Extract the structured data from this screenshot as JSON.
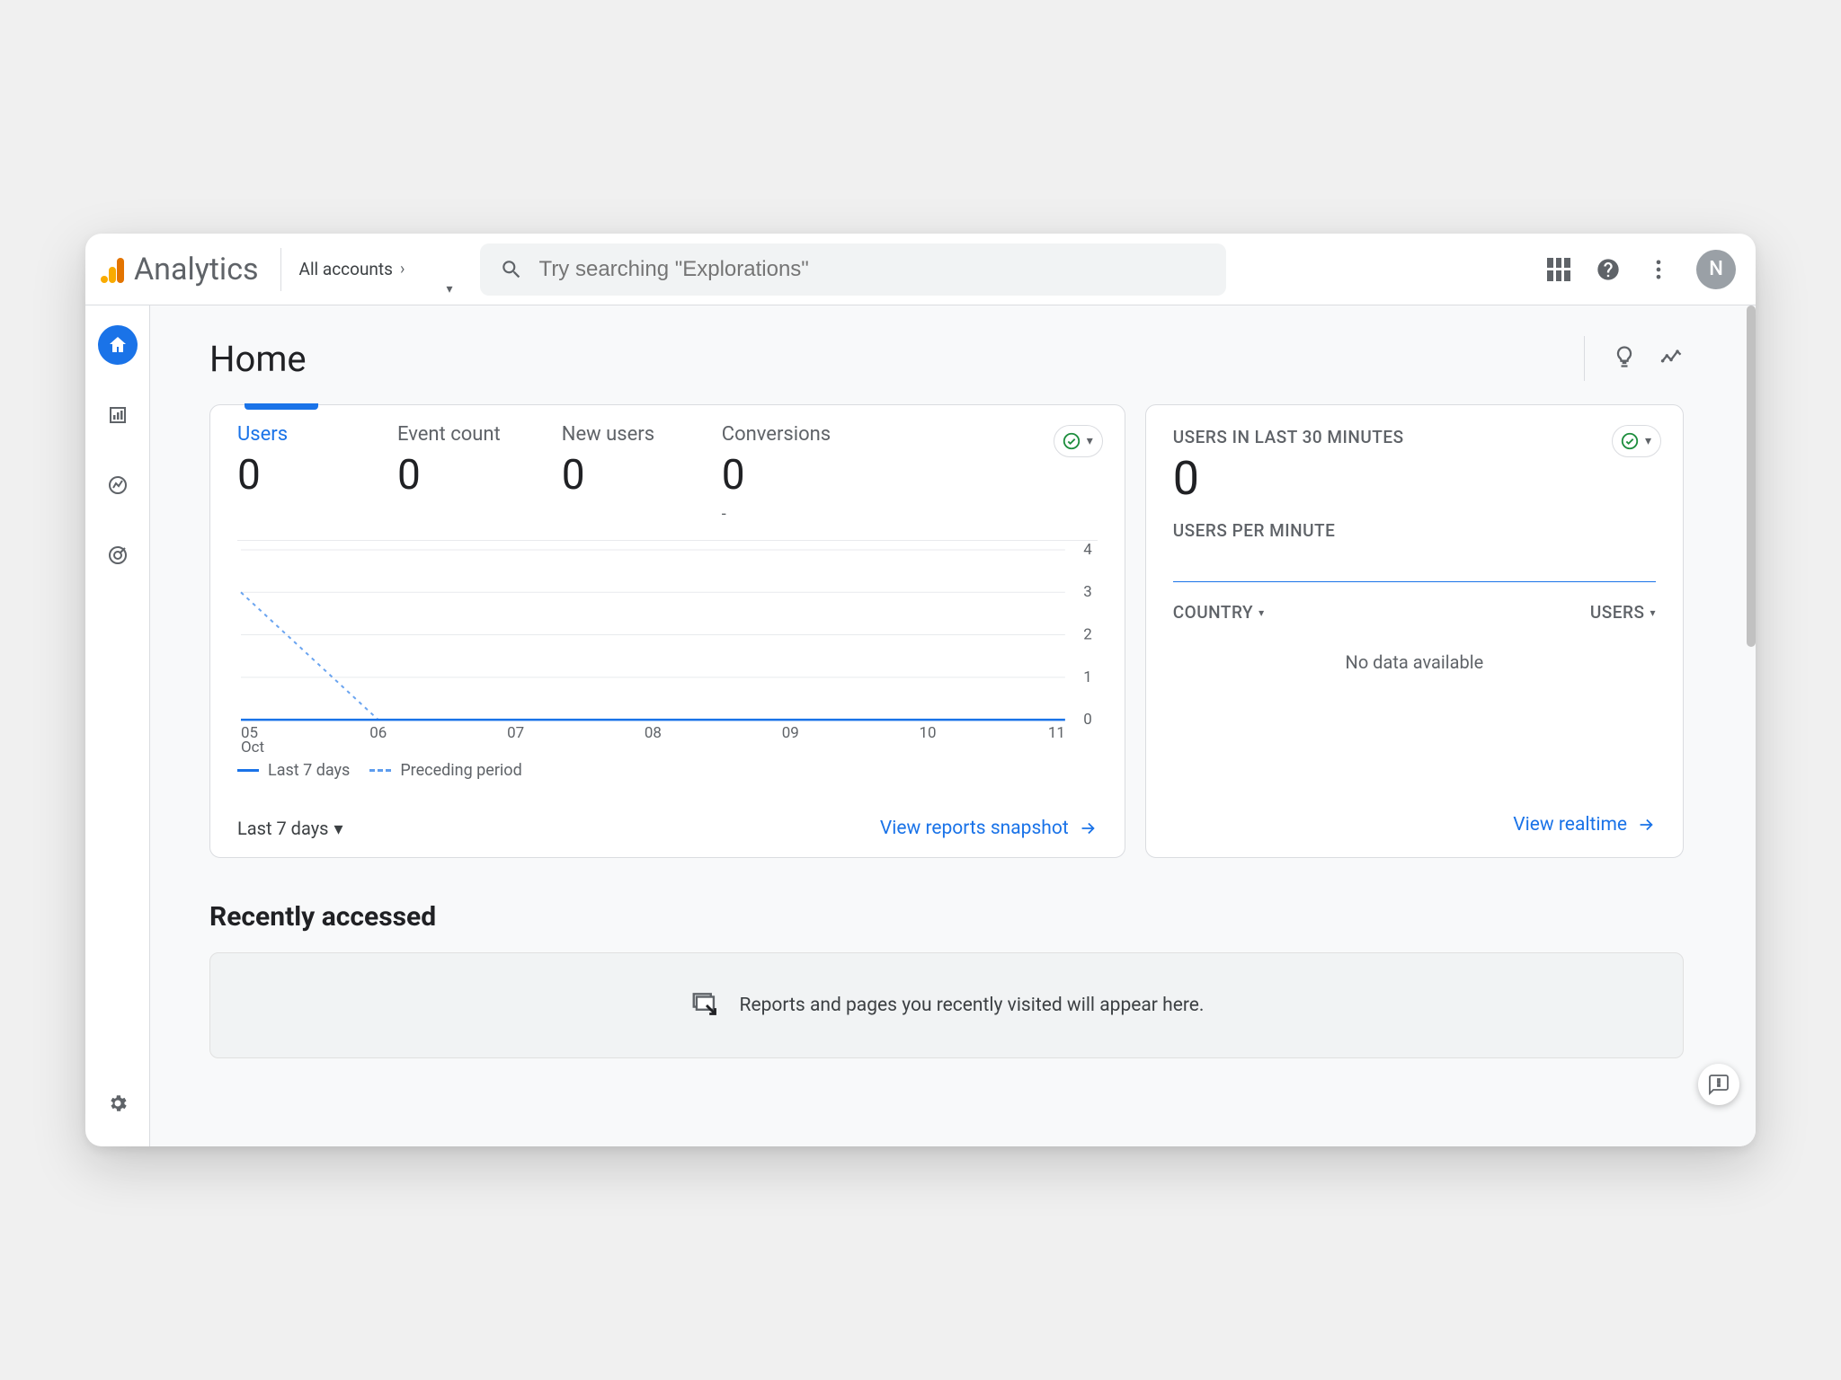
{
  "header": {
    "product_name": "Analytics",
    "account_label": "All accounts",
    "search_placeholder": "Try searching \"Explorations\"",
    "avatar_initial": "N"
  },
  "page": {
    "title": "Home"
  },
  "overview_card": {
    "metrics": [
      {
        "label": "Users",
        "value": "0",
        "sub": "",
        "active": true
      },
      {
        "label": "Event count",
        "value": "0",
        "sub": ""
      },
      {
        "label": "New users",
        "value": "0",
        "sub": ""
      },
      {
        "label": "Conversions",
        "value": "0",
        "sub": "-"
      }
    ],
    "legend": {
      "current": "Last 7 days",
      "previous": "Preceding period"
    },
    "date_range_label": "Last 7 days",
    "view_link": "View reports snapshot"
  },
  "realtime_card": {
    "title": "USERS IN LAST 30 MINUTES",
    "value": "0",
    "sub_title": "USERS PER MINUTE",
    "col_country": "COUNTRY",
    "col_users": "USERS",
    "no_data": "No data available",
    "view_link": "View realtime"
  },
  "recent": {
    "title": "Recently accessed",
    "empty_text": "Reports and pages you recently visited will appear here."
  },
  "chart_data": {
    "type": "line",
    "x_labels": [
      "05",
      "06",
      "07",
      "08",
      "09",
      "10",
      "11"
    ],
    "x_sub_label": "Oct",
    "ylim": [
      0,
      4
    ],
    "y_ticks": [
      0,
      1,
      2,
      3,
      4
    ],
    "series": [
      {
        "name": "Last 7 days",
        "style": "solid",
        "values": [
          0,
          0,
          0,
          0,
          0,
          0,
          0
        ]
      },
      {
        "name": "Preceding period",
        "style": "dashed",
        "values": [
          3,
          0,
          null,
          null,
          null,
          null,
          null
        ]
      }
    ]
  }
}
